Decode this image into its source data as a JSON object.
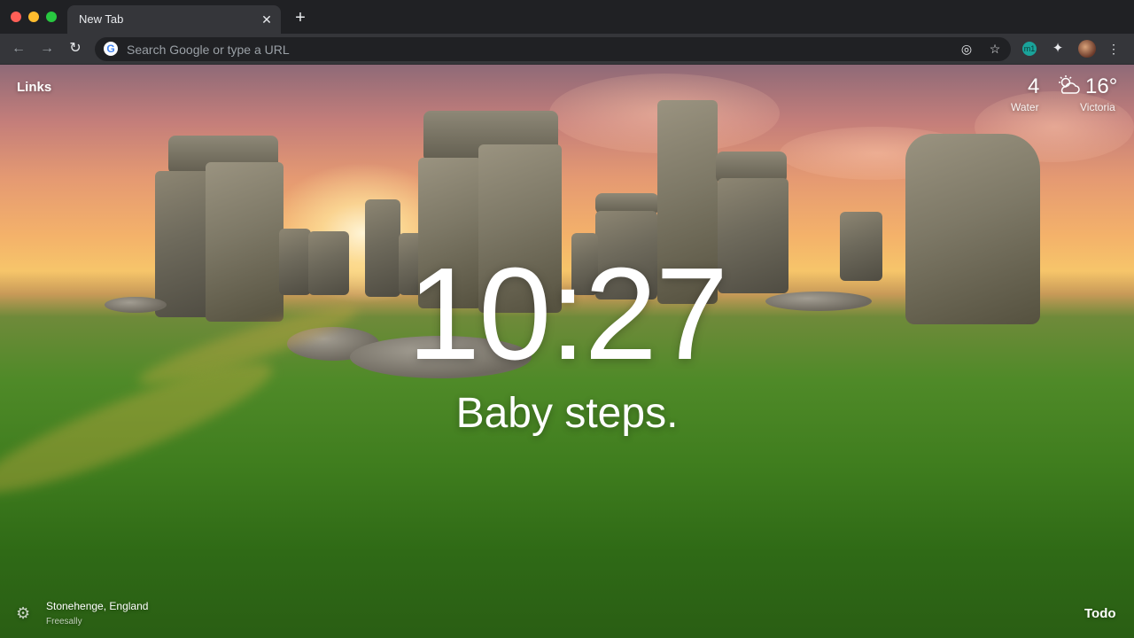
{
  "browser": {
    "tab": {
      "title": "New Tab",
      "close_glyph": "✕"
    },
    "new_tab_glyph": "+",
    "nav": {
      "back_glyph": "←",
      "forward_glyph": "→",
      "reload_glyph": "↻"
    },
    "omnibox": {
      "placeholder": "Search Google or type a URL",
      "logo_glyph": "G"
    },
    "omnibox_icons": {
      "lens_glyph": "◎",
      "star_glyph": "☆"
    },
    "extensions": {
      "m1_glyph": "m1",
      "puzzle_glyph": "✦",
      "menu_glyph": "⋮"
    }
  },
  "momentum": {
    "links_label": "Links",
    "weather": {
      "left_value": "4",
      "left_label": "Water",
      "icon": "partly-cloudy-icon",
      "temperature": "16°",
      "location": "Victoria"
    },
    "clock": "10:27",
    "mantra": "Baby steps.",
    "photo": {
      "location": "Stonehenge, England",
      "credit": "Freesally"
    },
    "settings_glyph": "⚙",
    "todo_label": "Todo"
  }
}
